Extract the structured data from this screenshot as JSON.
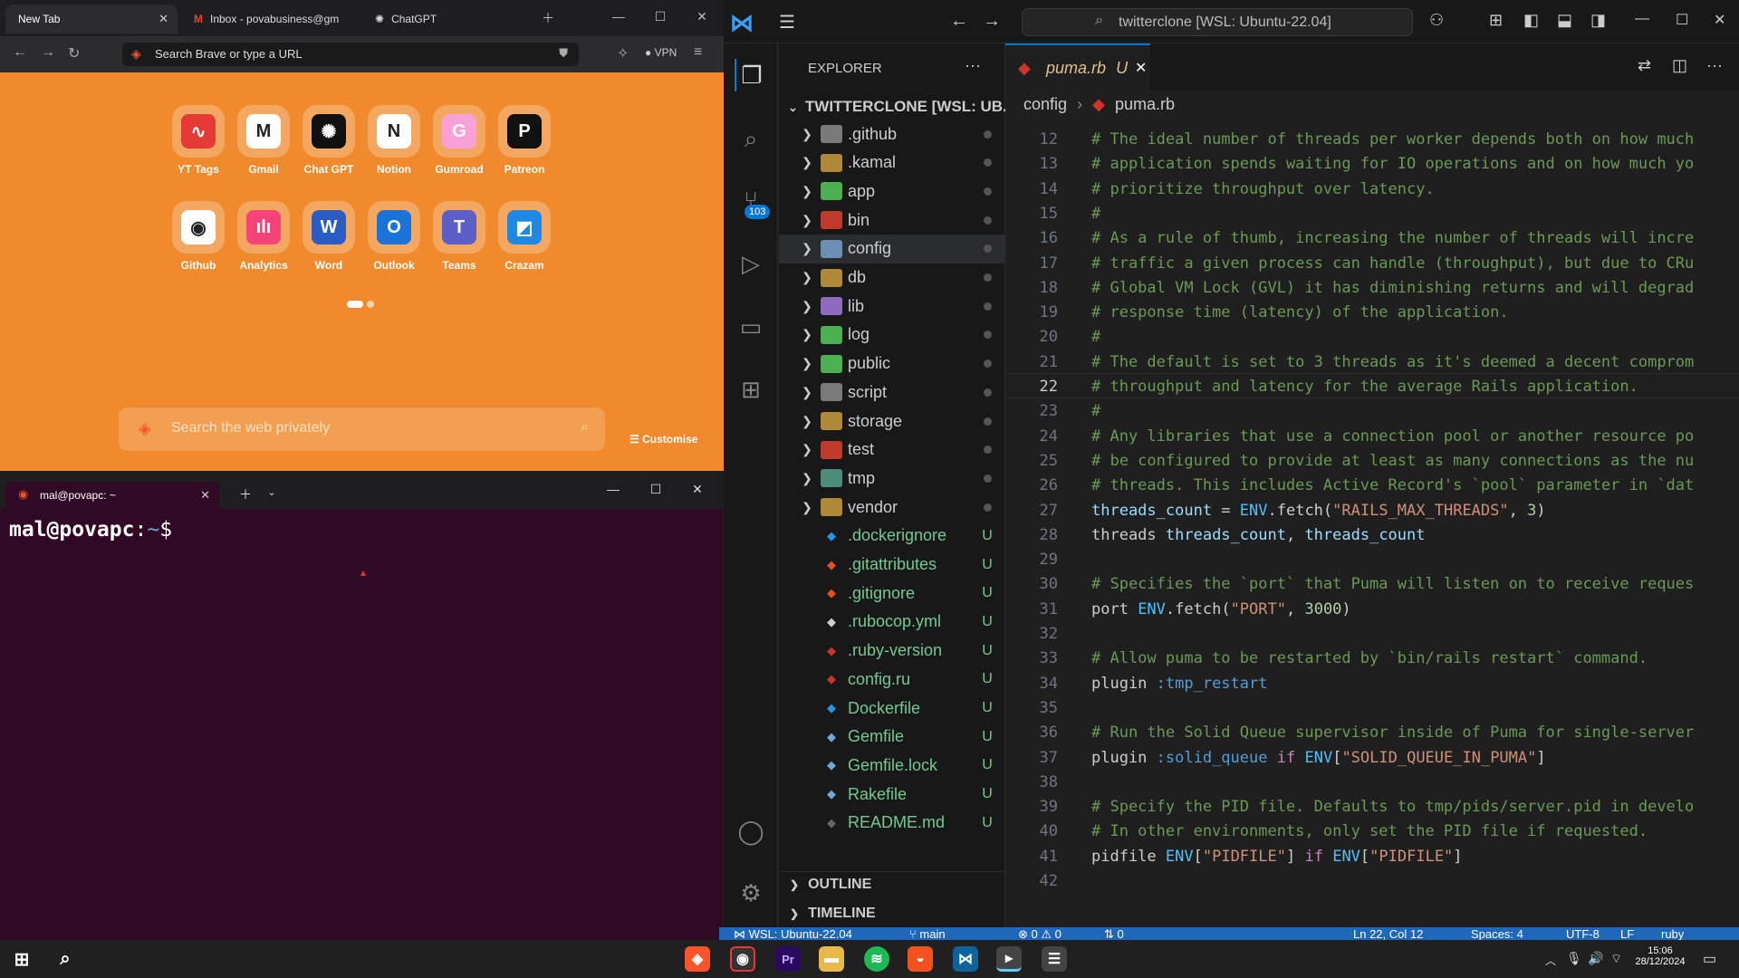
{
  "browser": {
    "tabs": [
      {
        "label": "New Tab"
      },
      {
        "label": "Inbox - povabusiness@gm"
      },
      {
        "label": "ChatGPT"
      }
    ],
    "url_placeholder": "Search Brave or type a URL",
    "vpn_label": "VPN",
    "tiles": [
      {
        "label": "YT Tags",
        "color": "#e53935",
        "glyph": "∿"
      },
      {
        "label": "Gmail",
        "color": "#ffffff",
        "glyph": "M"
      },
      {
        "label": "Chat GPT",
        "color": "#111111",
        "glyph": "✺"
      },
      {
        "label": "Notion",
        "color": "#ffffff",
        "glyph": "N"
      },
      {
        "label": "Gumroad",
        "color": "#f7a1d8",
        "glyph": "G"
      },
      {
        "label": "Patreon",
        "color": "#111111",
        "glyph": "P"
      },
      {
        "label": "Github",
        "color": "#ffffff",
        "glyph": "◉"
      },
      {
        "label": "Analytics",
        "color": "#f5437a",
        "glyph": "ılı"
      },
      {
        "label": "Word",
        "color": "#2b5cc4",
        "glyph": "W"
      },
      {
        "label": "Outlook",
        "color": "#1a73d9",
        "glyph": "O"
      },
      {
        "label": "Teams",
        "color": "#5b5fc7",
        "glyph": "T"
      },
      {
        "label": "Crazam",
        "color": "#1e88e5",
        "glyph": "◩"
      }
    ],
    "search_placeholder": "Search the web privately",
    "customise_label": "Customise"
  },
  "terminal": {
    "tab_title": "mal@povapc: ~",
    "prompt_user": "mal@povapc",
    "prompt_sep": ":",
    "prompt_path": "~",
    "prompt_symbol": "$"
  },
  "vscode": {
    "command_center": "twitterclone [WSL: Ubuntu-22.04]",
    "explorer_title": "EXPLORER",
    "project_title": "TWITTERCLONE [WSL: UB...",
    "scm_badge": "103",
    "folders": [
      {
        "name": ".github",
        "color": "#7a7a7a"
      },
      {
        "name": ".kamal",
        "color": "#b0883a"
      },
      {
        "name": "app",
        "color": "#4caf50"
      },
      {
        "name": "bin",
        "color": "#c0392b"
      },
      {
        "name": "config",
        "color": "#6d8fb5"
      },
      {
        "name": "db",
        "color": "#b0883a"
      },
      {
        "name": "lib",
        "color": "#8e6bbf"
      },
      {
        "name": "log",
        "color": "#4caf50"
      },
      {
        "name": "public",
        "color": "#4caf50"
      },
      {
        "name": "script",
        "color": "#7a7a7a"
      },
      {
        "name": "storage",
        "color": "#b0883a"
      },
      {
        "name": "test",
        "color": "#c0392b"
      },
      {
        "name": "tmp",
        "color": "#4c8c7a"
      },
      {
        "name": "vendor",
        "color": "#b0883a"
      }
    ],
    "files": [
      {
        "name": ".dockerignore",
        "color": "#2496ed",
        "status": "U"
      },
      {
        "name": ".gitattributes",
        "color": "#e44d26",
        "status": "U"
      },
      {
        "name": ".gitignore",
        "color": "#e44d26",
        "status": "U"
      },
      {
        "name": ".rubocop.yml",
        "color": "#cccccc",
        "status": "U"
      },
      {
        "name": ".ruby-version",
        "color": "#cc342d",
        "status": "U"
      },
      {
        "name": "config.ru",
        "color": "#cc342d",
        "status": "U"
      },
      {
        "name": "Dockerfile",
        "color": "#2496ed",
        "status": "U"
      },
      {
        "name": "Gemfile",
        "color": "#6fa8dc",
        "status": "U"
      },
      {
        "name": "Gemfile.lock",
        "color": "#6fa8dc",
        "status": "U"
      },
      {
        "name": "Rakefile",
        "color": "#6fa8dc",
        "status": "U"
      },
      {
        "name": "README.md",
        "color": "#666666",
        "status": "U"
      }
    ],
    "outline_label": "OUTLINE",
    "timeline_label": "TIMELINE",
    "open_tab": {
      "name": "puma.rb",
      "status": "U"
    },
    "breadcrumb": [
      "config",
      "puma.rb"
    ],
    "current_line": 22,
    "code_lines": [
      {
        "n": 12,
        "t": "# The ideal number of threads per worker depends both on how much"
      },
      {
        "n": 13,
        "t": "# application spends waiting for IO operations and on how much yo"
      },
      {
        "n": 14,
        "t": "# prioritize throughput over latency."
      },
      {
        "n": 15,
        "t": "#"
      },
      {
        "n": 16,
        "t": "# As a rule of thumb, increasing the number of threads will incre"
      },
      {
        "n": 17,
        "t": "# traffic a given process can handle (throughput), but due to CRu"
      },
      {
        "n": 18,
        "t": "# Global VM Lock (GVL) it has diminishing returns and will degrad"
      },
      {
        "n": 19,
        "t": "# response time (latency) of the application."
      },
      {
        "n": 20,
        "t": "#"
      },
      {
        "n": 21,
        "t": "# The default is set to 3 threads as it's deemed a decent comprom"
      },
      {
        "n": 22,
        "t": "# throughput and latency for the average Rails application."
      },
      {
        "n": 23,
        "t": "#"
      },
      {
        "n": 24,
        "t": "# Any libraries that use a connection pool or another resource po"
      },
      {
        "n": 25,
        "t": "# be configured to provide at least as many connections as the nu"
      },
      {
        "n": 26,
        "t": "# threads. This includes Active Record's `pool` parameter in `dat"
      },
      {
        "n": 27,
        "t": "threads_count = ENV.fetch(\"RAILS_MAX_THREADS\", 3)"
      },
      {
        "n": 28,
        "t": "threads threads_count, threads_count"
      },
      {
        "n": 29,
        "t": ""
      },
      {
        "n": 30,
        "t": "# Specifies the `port` that Puma will listen on to receive reques"
      },
      {
        "n": 31,
        "t": "port ENV.fetch(\"PORT\", 3000)"
      },
      {
        "n": 32,
        "t": ""
      },
      {
        "n": 33,
        "t": "# Allow puma to be restarted by `bin/rails restart` command."
      },
      {
        "n": 34,
        "t": "plugin :tmp_restart"
      },
      {
        "n": 35,
        "t": ""
      },
      {
        "n": 36,
        "t": "# Run the Solid Queue supervisor inside of Puma for single-server"
      },
      {
        "n": 37,
        "t": "plugin :solid_queue if ENV[\"SOLID_QUEUE_IN_PUMA\"]"
      },
      {
        "n": 38,
        "t": ""
      },
      {
        "n": 39,
        "t": "# Specify the PID file. Defaults to tmp/pids/server.pid in develo"
      },
      {
        "n": 40,
        "t": "# In other environments, only set the PID file if requested."
      },
      {
        "n": 41,
        "t": "pidfile ENV[\"PIDFILE\"] if ENV[\"PIDFILE\"]"
      },
      {
        "n": 42,
        "t": ""
      }
    ],
    "status": {
      "remote": "WSL: Ubuntu-22.04",
      "branch": "main",
      "problems": "0 ⚠ 0",
      "ports": "0",
      "position": "Ln 22, Col 12",
      "spaces": "Spaces: 4",
      "encoding": "UTF-8",
      "eol": "LF",
      "language": "ruby"
    }
  },
  "taskbar": {
    "time": "15:06",
    "date": "28/12/2024"
  },
  "colors": {
    "browser_bg": "#f08a2c",
    "terminal_bg": "#300a24",
    "vscode_bg": "#1f1f1f",
    "accent": "#0078d4",
    "status_bar": "#1f67b8"
  }
}
